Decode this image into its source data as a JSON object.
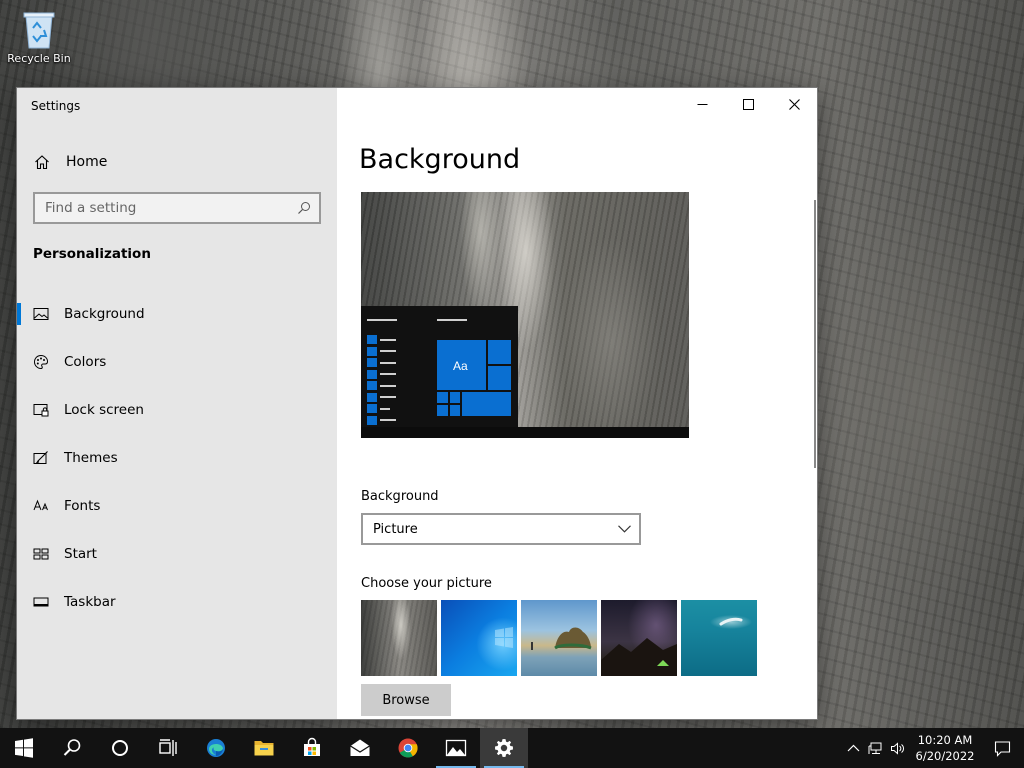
{
  "desktop": {
    "recycle_bin_label": "Recycle Bin"
  },
  "window": {
    "title": "Settings",
    "sidebar": {
      "home_label": "Home",
      "search_placeholder": "Find a setting",
      "section_title": "Personalization",
      "items": [
        {
          "label": "Background",
          "icon": "picture-icon",
          "active": true
        },
        {
          "label": "Colors",
          "icon": "palette-icon",
          "active": false
        },
        {
          "label": "Lock screen",
          "icon": "lock-screen-icon",
          "active": false
        },
        {
          "label": "Themes",
          "icon": "themes-icon",
          "active": false
        },
        {
          "label": "Fonts",
          "icon": "fonts-icon",
          "active": false
        },
        {
          "label": "Start",
          "icon": "start-icon",
          "active": false
        },
        {
          "label": "Taskbar",
          "icon": "taskbar-icon",
          "active": false
        }
      ]
    },
    "content": {
      "page_title": "Background",
      "preview_tile_text": "Aa",
      "background_label": "Background",
      "background_value": "Picture",
      "choose_picture_label": "Choose your picture",
      "browse_label": "Browse"
    }
  },
  "taskbar": {
    "apps": [
      "start-icon",
      "search-icon",
      "cortana-icon",
      "task-view-icon",
      "edge-icon",
      "file-explorer-icon",
      "store-icon",
      "mail-icon",
      "chrome-icon",
      "photos-icon",
      "settings-icon"
    ],
    "clock_time": "10:20 AM",
    "clock_date": "6/20/2022"
  },
  "colors": {
    "accent": "#0078d7",
    "sidebar_bg": "#e6e6e6",
    "taskbar_bg": "#121212"
  }
}
